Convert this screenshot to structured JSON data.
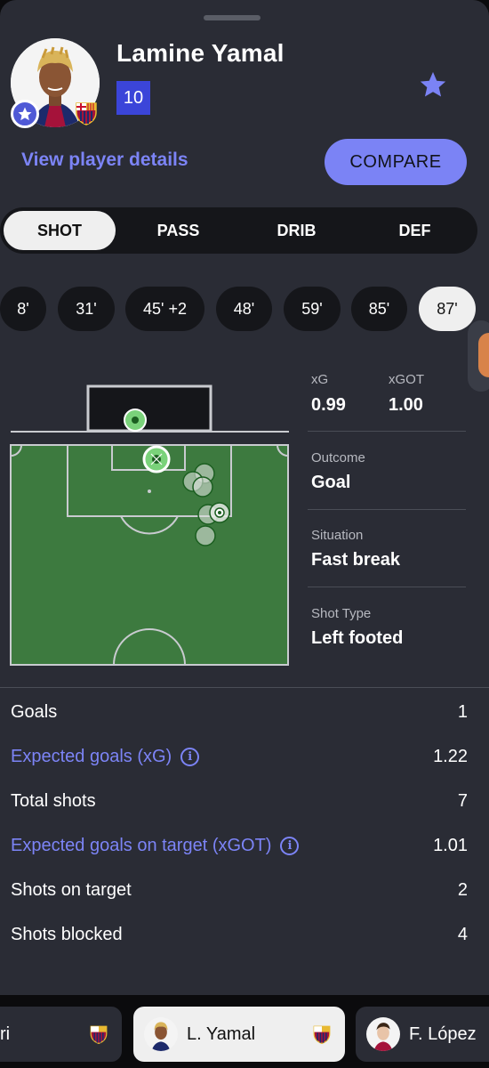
{
  "player": {
    "name": "Lamine Yamal",
    "number": "10",
    "details_link": "View player details",
    "compare_label": "COMPARE"
  },
  "tabs": [
    "SHOT",
    "PASS",
    "DRIB",
    "DEF"
  ],
  "active_tab": "SHOT",
  "minutes": [
    "8'",
    "31'",
    "45' +2",
    "48'",
    "59'",
    "85'",
    "87'"
  ],
  "active_minute": "87'",
  "shot_detail": {
    "xg_label": "xG",
    "xg_value": "0.99",
    "xgot_label": "xGOT",
    "xgot_value": "1.00",
    "outcome_label": "Outcome",
    "outcome_value": "Goal",
    "situation_label": "Situation",
    "situation_value": "Fast break",
    "shot_type_label": "Shot Type",
    "shot_type_value": "Left footed"
  },
  "stats": [
    {
      "label": "Goals",
      "value": "1",
      "info": false
    },
    {
      "label": "Expected goals (xG)",
      "value": "1.22",
      "info": true
    },
    {
      "label": "Total shots",
      "value": "7",
      "info": false
    },
    {
      "label": "Expected goals on target (xGOT)",
      "value": "1.01",
      "info": true
    },
    {
      "label": "Shots on target",
      "value": "2",
      "info": false
    },
    {
      "label": "Shots blocked",
      "value": "4",
      "info": false
    }
  ],
  "bottom_players": [
    {
      "name": "ri",
      "active": false
    },
    {
      "name": "L. Yamal",
      "active": true
    },
    {
      "name": "F. López",
      "active": false
    }
  ],
  "colors": {
    "accent": "#7b83f5",
    "pitch": "#3d7a3f",
    "sheet": "#2a2c35"
  },
  "icons": {
    "favorite": "star-icon",
    "info": "info-icon",
    "goal_ball": "football-icon",
    "club": "club-crest-icon"
  }
}
